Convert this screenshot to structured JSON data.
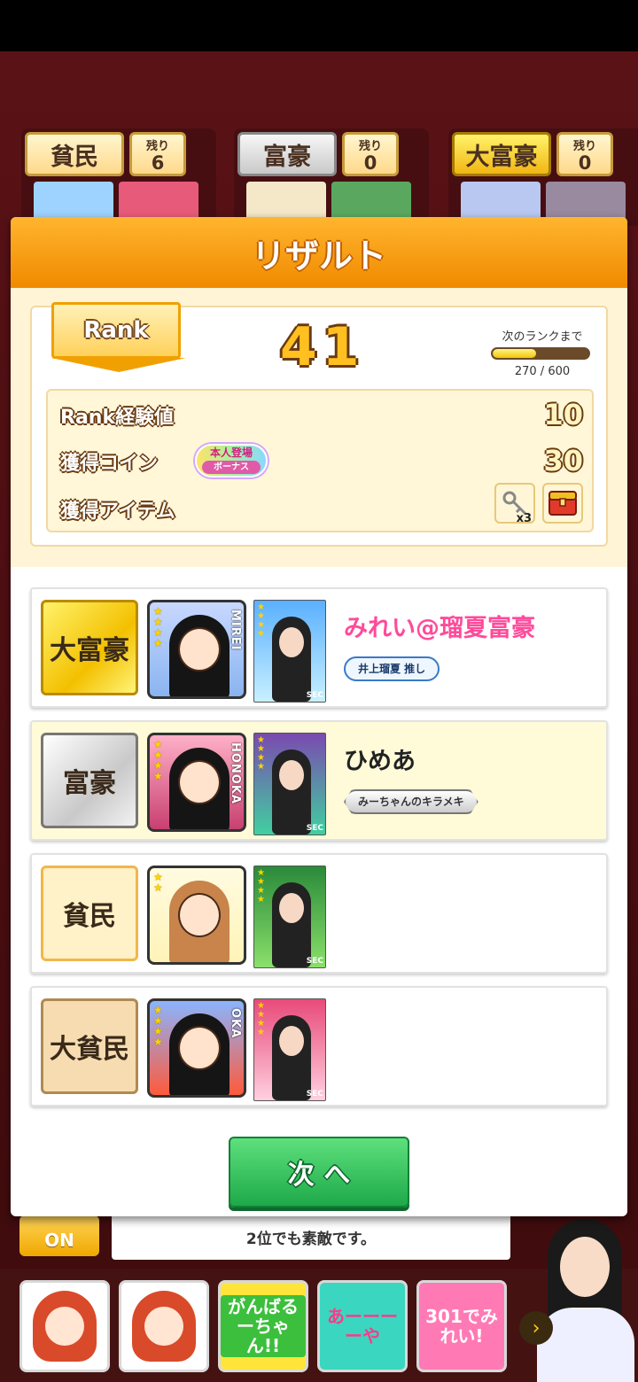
{
  "background": {
    "players": [
      {
        "title": "貧民",
        "remain_label": "残り",
        "remain": "6",
        "style": "cream"
      },
      {
        "title": "富豪",
        "remain_label": "残り",
        "remain": "0",
        "style": "silver"
      },
      {
        "title": "大富豪",
        "remain_label": "残り",
        "remain": "0",
        "style": "gold"
      }
    ],
    "chat_text": "2位でも素敵です。",
    "on_button": "ON",
    "stamps": [
      "がんばるーちゃん!!",
      "あーーーーや",
      "301でみれい!"
    ]
  },
  "modal": {
    "title": "リザルト",
    "rank": {
      "label": "Rank",
      "value": "41",
      "next_label": "次のランクまで",
      "progress_text": "270 / 600",
      "progress_fraction": 0.45
    },
    "stats": {
      "exp_label": "Rank経験値",
      "exp_value": "10",
      "coin_label": "獲得コイン",
      "coin_value": "30",
      "bonus_line1": "本人登場",
      "bonus_line2": "ボーナス",
      "item_label": "獲得アイテム",
      "key_count": "x3"
    },
    "results": [
      {
        "title": "大富豪",
        "avatar_name": "MIREI",
        "player": "みれい@瑠夏富豪",
        "tag": "井上瑠夏 推し"
      },
      {
        "title": "富豪",
        "avatar_name": "HONOKA",
        "player": "ひめあ",
        "tag": "みーちゃんのキラメキ"
      },
      {
        "title": "貧民",
        "avatar_name": "",
        "player": "",
        "tag": ""
      },
      {
        "title": "大貧民",
        "avatar_name": "OKA",
        "player": "",
        "tag": ""
      }
    ],
    "next_button": "次 へ",
    "photo_sec": "SEC"
  },
  "colors": {
    "header_orange": "#f08a00",
    "next_green": "#1ea94a",
    "name_pink": "#ff4a9a"
  }
}
